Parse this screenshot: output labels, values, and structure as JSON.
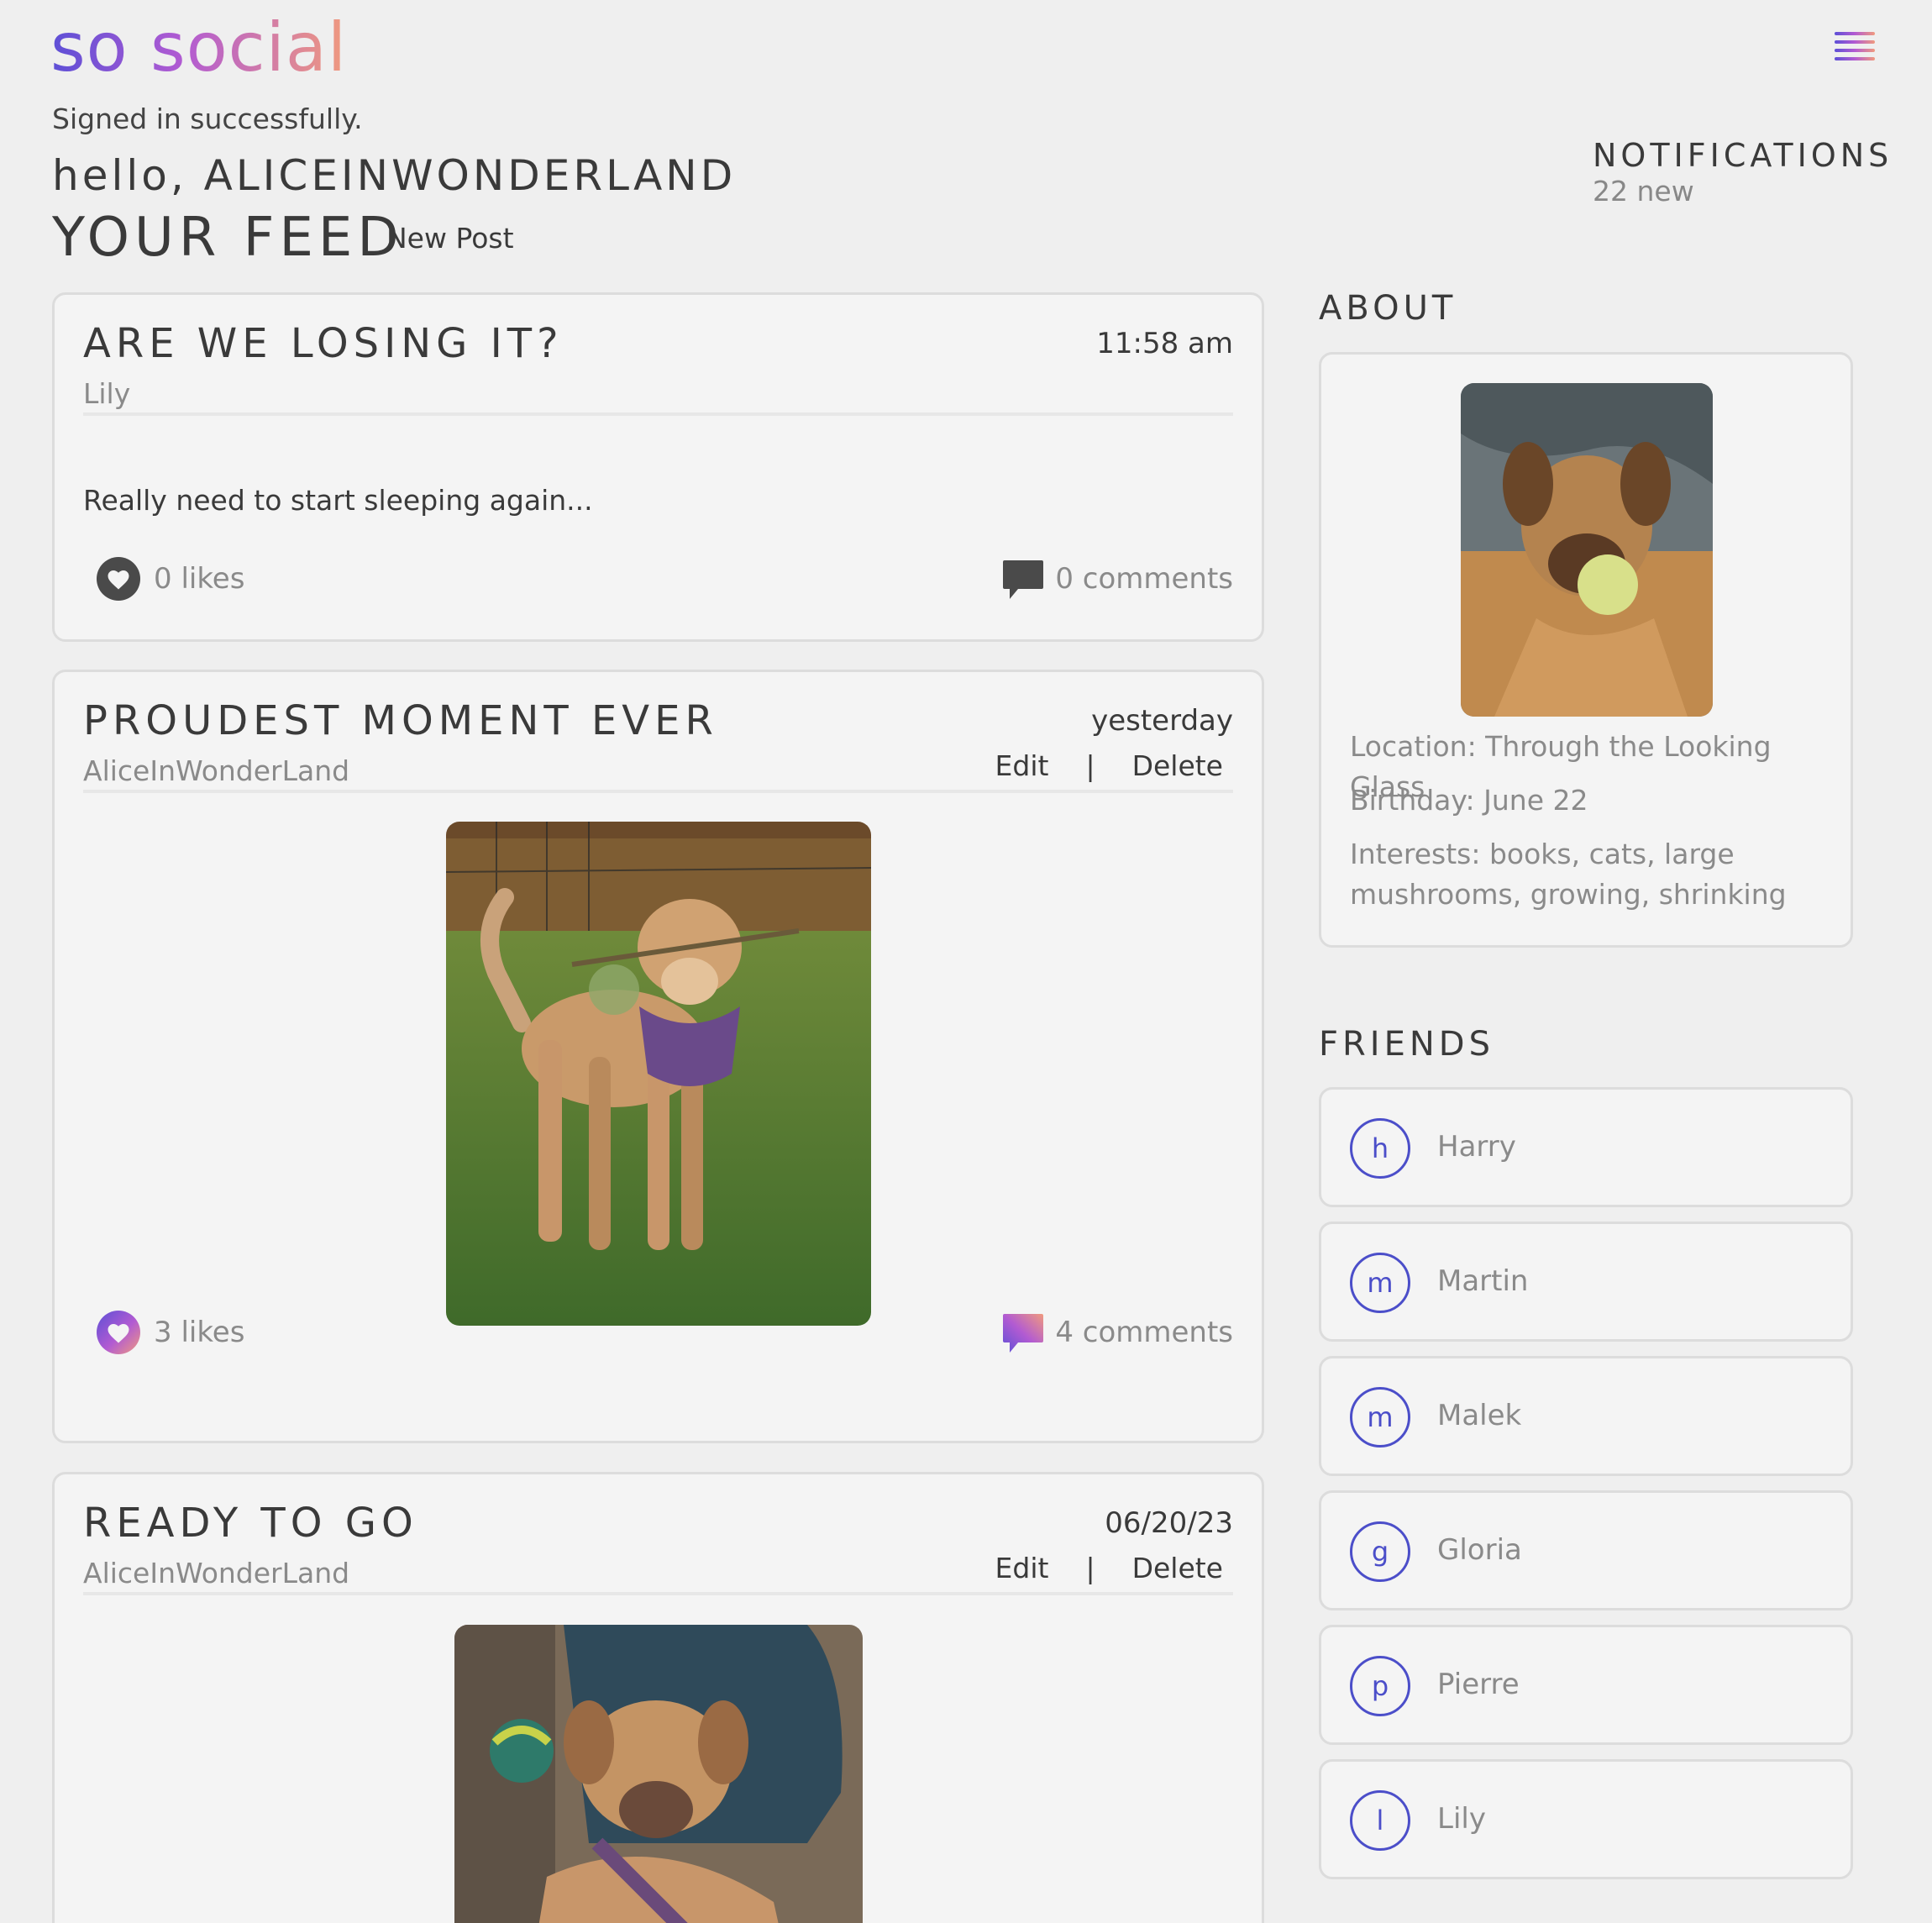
{
  "brand": {
    "logo_text": "so social",
    "gradient": [
      "#5d4fd6",
      "#b25bd2",
      "#f09a7e"
    ]
  },
  "header": {
    "flash": "Signed in successfully.",
    "greeting": "hello, ALICEINWONDERLAND",
    "feed_title": "YOUR FEED",
    "new_post_label": "New Post",
    "menu_icon": "hamburger-icon"
  },
  "notifications": {
    "title": "NOTIFICATIONS",
    "count_label": "22 new"
  },
  "posts": [
    {
      "title": "ARE WE LOSING IT?",
      "author": "Lily",
      "time": "11:58 am",
      "body": "Really need to start sleeping again...",
      "likes": "0 likes",
      "comments": "0 comments"
    },
    {
      "title": "PROUDEST MOMENT EVER",
      "author": "AliceInWonderLand",
      "time": "yesterday",
      "edit": "Edit",
      "sep": "|",
      "delete": "Delete",
      "likes": "3 likes",
      "comments": "4 comments"
    },
    {
      "title": "READY TO GO",
      "author": "AliceInWonderLand",
      "time": "06/20/23",
      "edit": "Edit",
      "sep": "|",
      "delete": "Delete"
    }
  ],
  "about": {
    "title": "ABOUT",
    "location": "Location: Through the Looking Glass",
    "birthday": "Birthday: June 22",
    "interests": "Interests: books, cats, large mushrooms, growing, shrinking"
  },
  "friends": {
    "title": "FRIENDS",
    "accent": "#4b4ec9",
    "items": [
      {
        "initial": "h",
        "name": "Harry"
      },
      {
        "initial": "m",
        "name": "Martin"
      },
      {
        "initial": "m",
        "name": "Malek"
      },
      {
        "initial": "g",
        "name": "Gloria"
      },
      {
        "initial": "p",
        "name": "Pierre"
      },
      {
        "initial": "l",
        "name": "Lily"
      }
    ]
  }
}
